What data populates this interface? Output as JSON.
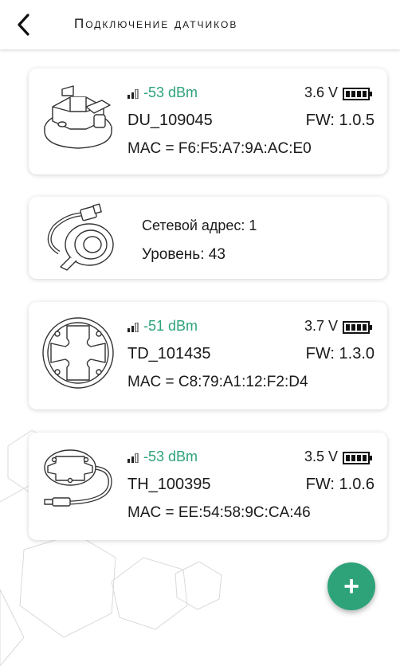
{
  "header": {
    "title": "Подключение датчиков",
    "back_icon": "chevron-left-icon"
  },
  "accent_color": "#2ea37a",
  "devices": [
    {
      "rssi": "-53 dBm",
      "voltage": "3.6 V",
      "name": "DU_109045",
      "fw": "FW: 1.0.5",
      "mac": "MAC = F6:F5:A7:9A:AC:E0",
      "image": "du-sensor-image"
    },
    {
      "address": "Сетевой адрес: 1",
      "level": "Уровень: 43",
      "image": "hub-sensor-image"
    },
    {
      "rssi": "-51 dBm",
      "voltage": "3.7 V",
      "name": "TD_101435",
      "fw": "FW: 1.3.0",
      "mac": "MAC = C8:79:A1:12:F2:D4",
      "image": "td-sensor-image"
    },
    {
      "rssi": "-53 dBm",
      "voltage": "3.5 V",
      "name": "TH_100395",
      "fw": "FW: 1.0.6",
      "mac": "MAC = EE:54:58:9C:CA:46",
      "image": "th-sensor-image"
    }
  ],
  "fab": {
    "icon": "plus-icon",
    "label": "+"
  }
}
